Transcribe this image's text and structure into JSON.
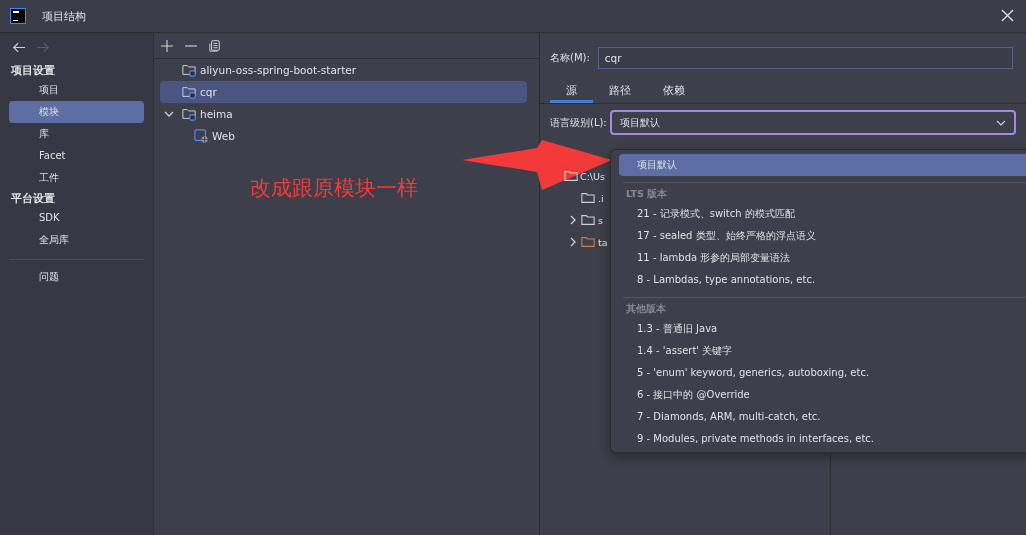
{
  "window": {
    "title": "项目结构"
  },
  "sidebar": {
    "groups": [
      {
        "heading": "项目设置",
        "items": [
          {
            "label": "项目",
            "selected": false
          },
          {
            "label": "模块",
            "selected": true
          },
          {
            "label": "库",
            "selected": false
          },
          {
            "label": "Facet",
            "selected": false
          },
          {
            "label": "工件",
            "selected": false
          }
        ]
      },
      {
        "heading": "平台设置",
        "items": [
          {
            "label": "SDK",
            "selected": false
          },
          {
            "label": "全局库",
            "selected": false
          }
        ]
      }
    ],
    "extra_items": [
      {
        "label": "问题",
        "selected": false
      }
    ]
  },
  "modules": [
    {
      "name": "aliyun-oss-spring-boot-starter",
      "selected": false,
      "kind": "module"
    },
    {
      "name": "cqr",
      "selected": true,
      "kind": "module"
    },
    {
      "name": "heima",
      "selected": false,
      "kind": "module",
      "expanded": true,
      "children": [
        {
          "name": "Web",
          "selected": false,
          "kind": "web"
        }
      ]
    }
  ],
  "name_field": {
    "label": "名称(M):",
    "value": "cqr"
  },
  "tabs": [
    {
      "label": "源",
      "selected": true
    },
    {
      "label": "路径",
      "selected": false
    },
    {
      "label": "依赖",
      "selected": false
    }
  ],
  "language_level": {
    "label": "语言级别(L):",
    "value": "项目默认"
  },
  "source_tree": [
    {
      "name": "C:\\Us",
      "kind": "folder",
      "children": [
        {
          "name": ".i",
          "kind": "folder",
          "expandable": false
        },
        {
          "name": "s",
          "kind": "folder",
          "expandable": true
        },
        {
          "name": "ta",
          "kind": "excluded",
          "expandable": true
        }
      ]
    }
  ],
  "dropdown": {
    "items": [
      {
        "kind": "option",
        "label": "项目默认",
        "selected": true
      },
      {
        "kind": "header",
        "label": "LTS 版本"
      },
      {
        "kind": "option",
        "label": "21 - 记录模式、switch 的模式匹配",
        "selected": false
      },
      {
        "kind": "option",
        "label": "17 - sealed 类型、始终严格的浮点语义",
        "selected": false
      },
      {
        "kind": "option",
        "label": "11 - lambda 形参的局部变量语法",
        "selected": false
      },
      {
        "kind": "option",
        "label": "8 - Lambdas, type annotations, etc.",
        "selected": false
      },
      {
        "kind": "header",
        "label": "其他版本"
      },
      {
        "kind": "option",
        "label": "1.3 - 普通旧 Java",
        "selected": false
      },
      {
        "kind": "option",
        "label": "1.4 - 'assert' 关键字",
        "selected": false
      },
      {
        "kind": "option",
        "label": "5 - 'enum' keyword, generics, autoboxing, etc.",
        "selected": false
      },
      {
        "kind": "option",
        "label": "6 - 接口中的 @Override",
        "selected": false
      },
      {
        "kind": "option",
        "label": "7 - Diamonds, ARM, multi-catch, etc.",
        "selected": false
      },
      {
        "kind": "option",
        "label": "9 - Modules, private methods in interfaces, etc.",
        "selected": false
      }
    ]
  },
  "annotation": {
    "text": "改成跟原模块一样"
  }
}
